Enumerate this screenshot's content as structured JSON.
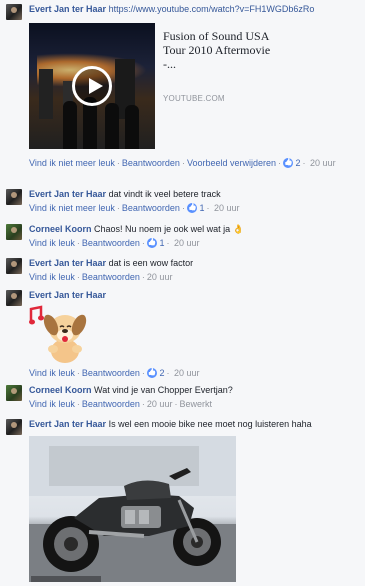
{
  "comments": [
    {
      "author": "Evert Jan ter Haar",
      "text": "",
      "link": "https://www.youtube.com/watch?v=FH1WGDb6zRo",
      "preview": {
        "title": "Fusion of Sound USA Tour 2010 Aftermovie -...",
        "domain": "YOUTUBE.COM"
      },
      "actions": [
        "Vind ik niet meer leuk",
        "Beantwoorden",
        "Voorbeeld verwijderen"
      ],
      "likes": "2",
      "time": "20 uur"
    },
    {
      "author": "Evert Jan ter Haar",
      "text": "dat vindt ik veel betere track",
      "actions": [
        "Vind ik niet meer leuk",
        "Beantwoorden"
      ],
      "likes": "1",
      "time": "20 uur"
    },
    {
      "author": "Corneel Koorn",
      "text": "Chaos! Nu noem je ook wel wat ja",
      "emoji": "👌",
      "actions": [
        "Vind ik leuk",
        "Beantwoorden"
      ],
      "likes": "1",
      "time": "20 uur"
    },
    {
      "author": "Evert Jan ter Haar",
      "text": "dat is een wow factor",
      "actions": [
        "Vind ik leuk",
        "Beantwoorden"
      ],
      "time": "20 uur"
    },
    {
      "author": "Evert Jan ter Haar",
      "text": "",
      "actions": [
        "Vind ik leuk",
        "Beantwoorden"
      ],
      "likes": "2",
      "time": "20 uur"
    },
    {
      "author": "Corneel Koorn",
      "text": "Wat vind je van Chopper Evertjan?",
      "actions": [
        "Vind ik leuk",
        "Beantwoorden"
      ],
      "time": "20 uur",
      "edited": "Bewerkt"
    },
    {
      "author": "Evert Jan ter Haar",
      "text": "Is wel een mooie bike nee moet nog luisteren haha"
    }
  ],
  "colors": {
    "name": "#365899",
    "action": "#4267b2",
    "meta": "#90949c",
    "like": "#5890ff"
  },
  "icons": {
    "like": "thumbs-up-icon",
    "play": "play-icon"
  }
}
